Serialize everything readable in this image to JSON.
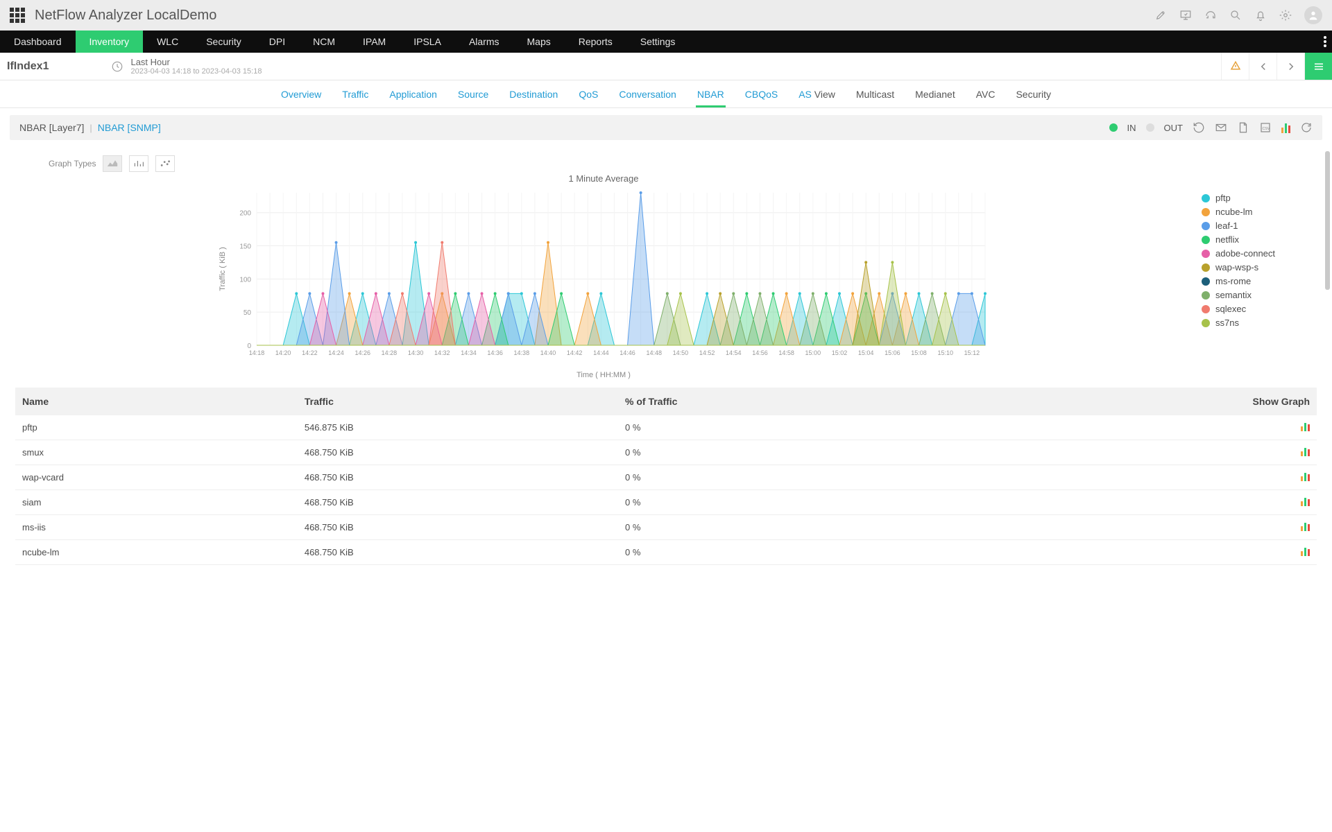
{
  "app_title": "NetFlow Analyzer LocalDemo",
  "nav": [
    "Dashboard",
    "Inventory",
    "WLC",
    "Security",
    "DPI",
    "NCM",
    "IPAM",
    "IPSLA",
    "Alarms",
    "Maps",
    "Reports",
    "Settings"
  ],
  "nav_active": "Inventory",
  "interface": "IfIndex1",
  "time": {
    "label": "Last Hour",
    "range": "2023-04-03 14:18 to 2023-04-03 15:18"
  },
  "htabs": [
    {
      "t": "Overview"
    },
    {
      "t": "Traffic"
    },
    {
      "t": "Application"
    },
    {
      "t": "Source"
    },
    {
      "t": "Destination"
    },
    {
      "t": "QoS"
    },
    {
      "t": "Conversation"
    },
    {
      "t": "NBAR",
      "active": true
    },
    {
      "t": "CBQoS"
    },
    {
      "t": "AS",
      "suf": " View"
    },
    {
      "t": "Multicast",
      "dark": true
    },
    {
      "t": "Medianet",
      "dark": true
    },
    {
      "t": "AVC",
      "dark": true
    },
    {
      "t": "Security",
      "dark": true
    }
  ],
  "sub": {
    "l7": "NBAR [Layer7]",
    "snmp": "NBAR [SNMP]",
    "in": "IN",
    "out": "OUT"
  },
  "graph_types_label": "Graph Types",
  "legend": [
    {
      "name": "pftp",
      "c": "#2cc7d6"
    },
    {
      "name": "ncube-lm",
      "c": "#f2a33c"
    },
    {
      "name": "leaf-1",
      "c": "#5a9de8"
    },
    {
      "name": "netflix",
      "c": "#2ecc71"
    },
    {
      "name": "adobe-connect",
      "c": "#e65fa7"
    },
    {
      "name": "wap-wsp-s",
      "c": "#b8a12c"
    },
    {
      "name": "ms-rome",
      "c": "#1c5f7a"
    },
    {
      "name": "semantix",
      "c": "#7fb06b"
    },
    {
      "name": "sqlexec",
      "c": "#f07b6e"
    },
    {
      "name": "ss7ns",
      "c": "#a7c24a"
    }
  ],
  "chart_data": {
    "type": "area",
    "title": "1 Minute Average",
    "xlabel": "Time ( HH:MM )",
    "ylabel": "Traffic ( KiB )",
    "ylim": [
      0,
      230
    ],
    "yticks": [
      0,
      50,
      100,
      150,
      200
    ],
    "categories": [
      "14:18",
      "14:19",
      "14:20",
      "14:21",
      "14:22",
      "14:23",
      "14:24",
      "14:25",
      "14:26",
      "14:27",
      "14:28",
      "14:29",
      "14:30",
      "14:31",
      "14:32",
      "14:33",
      "14:34",
      "14:35",
      "14:36",
      "14:37",
      "14:38",
      "14:39",
      "14:40",
      "14:41",
      "14:42",
      "14:43",
      "14:44",
      "14:45",
      "14:46",
      "14:47",
      "14:48",
      "14:49",
      "14:50",
      "14:51",
      "14:52",
      "14:53",
      "14:54",
      "14:55",
      "14:56",
      "14:57",
      "14:58",
      "14:59",
      "15:00",
      "15:01",
      "15:02",
      "15:03",
      "15:04",
      "15:05",
      "15:06",
      "15:07",
      "15:08",
      "15:09",
      "15:10",
      "15:11",
      "15:12",
      "15:13"
    ],
    "xticks": [
      "14:18",
      "14:20",
      "14:22",
      "14:24",
      "14:26",
      "14:28",
      "14:30",
      "14:32",
      "14:34",
      "14:36",
      "14:38",
      "14:40",
      "14:42",
      "14:44",
      "14:46",
      "14:48",
      "14:50",
      "14:52",
      "14:54",
      "14:56",
      "14:58",
      "15:00",
      "15:02",
      "15:04",
      "15:06",
      "15:08",
      "15:10",
      "15:12"
    ],
    "series": [
      {
        "name": "pftp",
        "color": "#2cc7d6",
        "values": [
          0,
          0,
          0,
          78,
          0,
          0,
          0,
          0,
          78,
          0,
          0,
          0,
          155,
          0,
          0,
          0,
          0,
          0,
          0,
          78,
          78,
          0,
          0,
          0,
          0,
          0,
          78,
          0,
          0,
          0,
          0,
          0,
          0,
          0,
          78,
          0,
          0,
          0,
          0,
          0,
          0,
          78,
          0,
          0,
          78,
          0,
          0,
          0,
          0,
          0,
          78,
          0,
          0,
          0,
          0,
          78
        ]
      },
      {
        "name": "ncube-lm",
        "color": "#f2a33c",
        "values": [
          0,
          0,
          0,
          0,
          0,
          0,
          0,
          78,
          0,
          0,
          0,
          0,
          0,
          0,
          78,
          0,
          0,
          0,
          0,
          0,
          0,
          0,
          155,
          0,
          0,
          78,
          0,
          0,
          0,
          0,
          0,
          0,
          0,
          0,
          0,
          0,
          0,
          0,
          0,
          0,
          78,
          0,
          0,
          0,
          0,
          78,
          0,
          78,
          0,
          78,
          0,
          0,
          0,
          0,
          0,
          0
        ]
      },
      {
        "name": "leaf-1",
        "color": "#5a9de8",
        "values": [
          0,
          0,
          0,
          0,
          78,
          0,
          155,
          0,
          0,
          0,
          78,
          0,
          0,
          0,
          0,
          0,
          78,
          0,
          0,
          78,
          0,
          78,
          0,
          0,
          0,
          0,
          0,
          0,
          0,
          230,
          0,
          0,
          0,
          0,
          0,
          0,
          0,
          0,
          0,
          0,
          0,
          0,
          0,
          0,
          0,
          0,
          0,
          0,
          78,
          0,
          0,
          0,
          0,
          78,
          78,
          0
        ]
      },
      {
        "name": "netflix",
        "color": "#2ecc71",
        "values": [
          0,
          0,
          0,
          0,
          0,
          0,
          0,
          0,
          0,
          0,
          0,
          0,
          0,
          0,
          0,
          78,
          0,
          0,
          78,
          0,
          0,
          0,
          0,
          78,
          0,
          0,
          0,
          0,
          0,
          0,
          0,
          0,
          0,
          0,
          0,
          0,
          0,
          78,
          0,
          78,
          0,
          0,
          0,
          78,
          0,
          0,
          78,
          0,
          0,
          0,
          0,
          0,
          0,
          0,
          0,
          0
        ]
      },
      {
        "name": "adobe-connect",
        "color": "#e65fa7",
        "values": [
          0,
          0,
          0,
          0,
          0,
          78,
          0,
          0,
          0,
          78,
          0,
          0,
          0,
          78,
          0,
          0,
          0,
          78,
          0,
          0,
          0,
          0,
          0,
          0,
          0,
          0,
          0,
          0,
          0,
          0,
          0,
          0,
          0,
          0,
          0,
          0,
          0,
          0,
          0,
          0,
          0,
          0,
          0,
          0,
          0,
          0,
          0,
          0,
          0,
          0,
          0,
          0,
          0,
          0,
          0,
          0
        ]
      },
      {
        "name": "wap-wsp-s",
        "color": "#b8a12c",
        "values": [
          0,
          0,
          0,
          0,
          0,
          0,
          0,
          0,
          0,
          0,
          0,
          0,
          0,
          0,
          0,
          0,
          0,
          0,
          0,
          0,
          0,
          0,
          0,
          0,
          0,
          0,
          0,
          0,
          0,
          0,
          0,
          0,
          0,
          0,
          0,
          78,
          0,
          0,
          0,
          0,
          0,
          0,
          0,
          0,
          0,
          0,
          125,
          0,
          0,
          0,
          0,
          0,
          0,
          0,
          0,
          0
        ]
      },
      {
        "name": "ms-rome",
        "color": "#1c5f7a",
        "values": [
          0,
          0,
          0,
          0,
          0,
          0,
          0,
          0,
          0,
          0,
          0,
          0,
          0,
          0,
          0,
          0,
          0,
          0,
          0,
          0,
          0,
          0,
          0,
          0,
          0,
          0,
          0,
          0,
          0,
          0,
          0,
          0,
          0,
          0,
          0,
          0,
          0,
          0,
          0,
          0,
          0,
          0,
          0,
          0,
          0,
          0,
          0,
          0,
          0,
          0,
          0,
          0,
          0,
          0,
          0,
          0
        ]
      },
      {
        "name": "semantix",
        "color": "#7fb06b",
        "values": [
          0,
          0,
          0,
          0,
          0,
          0,
          0,
          0,
          0,
          0,
          0,
          0,
          0,
          0,
          0,
          0,
          0,
          0,
          0,
          0,
          0,
          0,
          0,
          0,
          0,
          0,
          0,
          0,
          0,
          0,
          0,
          78,
          0,
          0,
          0,
          0,
          78,
          0,
          78,
          0,
          0,
          0,
          78,
          0,
          0,
          0,
          0,
          0,
          0,
          0,
          0,
          78,
          0,
          0,
          0,
          0
        ]
      },
      {
        "name": "sqlexec",
        "color": "#f07b6e",
        "values": [
          0,
          0,
          0,
          0,
          0,
          0,
          0,
          0,
          0,
          0,
          0,
          78,
          0,
          0,
          155,
          0,
          0,
          0,
          0,
          0,
          0,
          0,
          0,
          0,
          0,
          0,
          0,
          0,
          0,
          0,
          0,
          0,
          0,
          0,
          0,
          0,
          0,
          0,
          0,
          0,
          0,
          0,
          0,
          0,
          0,
          0,
          0,
          0,
          0,
          0,
          0,
          0,
          0,
          0,
          0,
          0
        ]
      },
      {
        "name": "ss7ns",
        "color": "#a7c24a",
        "values": [
          0,
          0,
          0,
          0,
          0,
          0,
          0,
          0,
          0,
          0,
          0,
          0,
          0,
          0,
          0,
          0,
          0,
          0,
          0,
          0,
          0,
          0,
          0,
          0,
          0,
          0,
          0,
          0,
          0,
          0,
          0,
          0,
          78,
          0,
          0,
          0,
          0,
          0,
          0,
          0,
          0,
          0,
          0,
          0,
          0,
          0,
          0,
          0,
          125,
          0,
          0,
          0,
          78,
          0,
          0,
          0
        ]
      }
    ]
  },
  "table": {
    "headers": [
      "Name",
      "Traffic",
      "% of Traffic",
      "Show Graph"
    ],
    "rows": [
      {
        "name": "pftp",
        "traffic": "546.875 KiB",
        "pct": "0 %"
      },
      {
        "name": "smux",
        "traffic": "468.750 KiB",
        "pct": "0 %"
      },
      {
        "name": "wap-vcard",
        "traffic": "468.750 KiB",
        "pct": "0 %"
      },
      {
        "name": "siam",
        "traffic": "468.750 KiB",
        "pct": "0 %"
      },
      {
        "name": "ms-iis",
        "traffic": "468.750 KiB",
        "pct": "0 %"
      },
      {
        "name": "ncube-lm",
        "traffic": "468.750 KiB",
        "pct": "0 %"
      }
    ]
  }
}
